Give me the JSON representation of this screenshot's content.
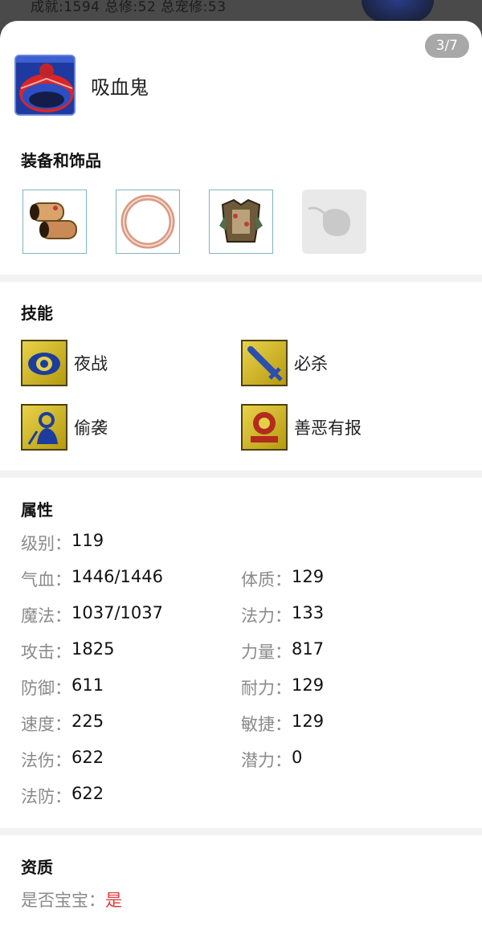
{
  "backdrop": {
    "text": "成就:1594  总修:52  总宠修:53"
  },
  "pager": {
    "label": "3/7"
  },
  "pet": {
    "name": "吸血鬼",
    "avatar_icon": "vampire-pet-avatar"
  },
  "sections": {
    "equipment": "装备和饰品",
    "skills": "技能",
    "attributes": "属性",
    "aptitude": "资质"
  },
  "equipment": [
    {
      "icon": "bracer-icon"
    },
    {
      "icon": "ring-icon"
    },
    {
      "icon": "armor-icon"
    },
    {
      "icon": "empty-slot-icon"
    }
  ],
  "skills": [
    {
      "label": "夜战",
      "icon": "night-battle-icon"
    },
    {
      "label": "必杀",
      "icon": "critical-sword-icon"
    },
    {
      "label": "偷袭",
      "icon": "sneak-attack-icon"
    },
    {
      "label": "善恶有报",
      "icon": "karma-icon"
    }
  ],
  "attributes": {
    "level": {
      "k": "级别：",
      "v": "119"
    },
    "hp": {
      "k": "气血：",
      "v": "1446/1446"
    },
    "mp": {
      "k": "魔法：",
      "v": "1037/1037"
    },
    "atk": {
      "k": "攻击：",
      "v": "1825"
    },
    "def": {
      "k": "防御：",
      "v": "611"
    },
    "spd": {
      "k": "速度：",
      "v": "225"
    },
    "mag_atk": {
      "k": "法伤：",
      "v": "622"
    },
    "mag_def": {
      "k": "法防：",
      "v": "622"
    },
    "con": {
      "k": "体质：",
      "v": "129"
    },
    "mag": {
      "k": "法力：",
      "v": "133"
    },
    "str": {
      "k": "力量：",
      "v": "817"
    },
    "end": {
      "k": "耐力：",
      "v": "129"
    },
    "agi": {
      "k": "敏捷：",
      "v": "129"
    },
    "pot": {
      "k": "潜力：",
      "v": "0"
    }
  },
  "aptitude": {
    "is_baby": {
      "k": "是否宝宝：",
      "v": "是"
    }
  },
  "colors": {
    "accent_red": "#e23b3b",
    "label_gray": "#8a8a8a"
  }
}
